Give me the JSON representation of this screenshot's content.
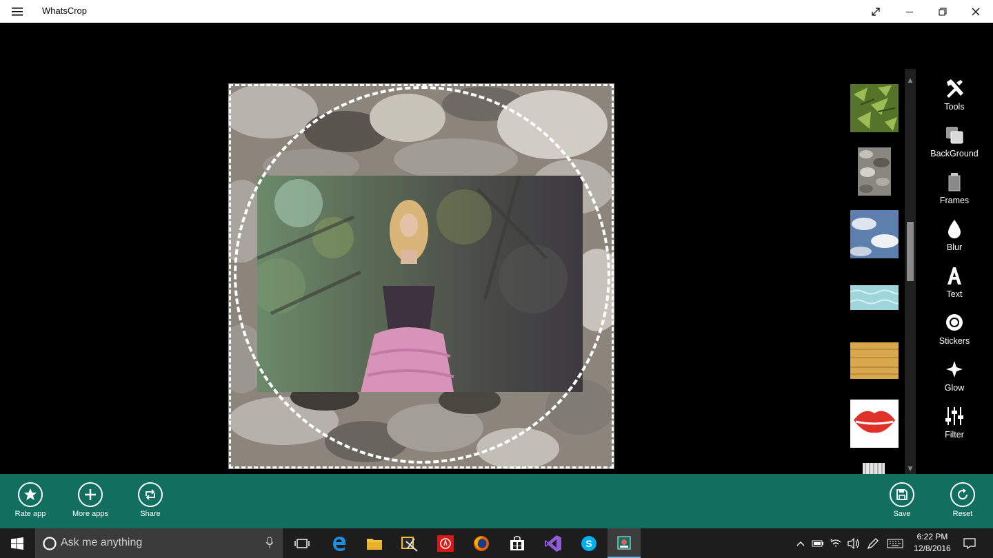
{
  "window": {
    "title": "WhatsCrop"
  },
  "tools": [
    {
      "label": "Tools",
      "icon": "hammer-wrench-icon"
    },
    {
      "label": "BackGround",
      "icon": "layers-icon"
    },
    {
      "label": "Frames",
      "icon": "frame-icon"
    },
    {
      "label": "Blur",
      "icon": "drop-icon"
    },
    {
      "label": "Text",
      "icon": "text-a-icon"
    },
    {
      "label": "Stickers",
      "icon": "sticker-icon"
    },
    {
      "label": "Glow",
      "icon": "sparkle-icon"
    },
    {
      "label": "Filter",
      "icon": "sliders-icon"
    }
  ],
  "backgrounds": [
    {
      "name": "leaves",
      "color": "#5f7d2e"
    },
    {
      "name": "pebbles",
      "color": "#8a8780"
    },
    {
      "name": "clouds",
      "color": "#6e8bb3"
    },
    {
      "name": "water",
      "color": "#9fd6dc"
    },
    {
      "name": "wood",
      "color": "#d7a94d"
    },
    {
      "name": "lips",
      "color": "#e23a2f"
    },
    {
      "name": "stripes",
      "color": "#d9d9d9"
    }
  ],
  "appbar": {
    "left": [
      {
        "label": "Rate app",
        "icon": "star-icon"
      },
      {
        "label": "More apps",
        "icon": "plus-icon"
      },
      {
        "label": "Share",
        "icon": "share-icon"
      }
    ],
    "right": [
      {
        "label": "Save",
        "icon": "save-icon"
      },
      {
        "label": "Reset",
        "icon": "reset-icon"
      }
    ],
    "color": "#126f60"
  },
  "taskbar": {
    "search_placeholder": "Ask me anything",
    "time": "6:22 PM",
    "date": "12/8/2016"
  }
}
